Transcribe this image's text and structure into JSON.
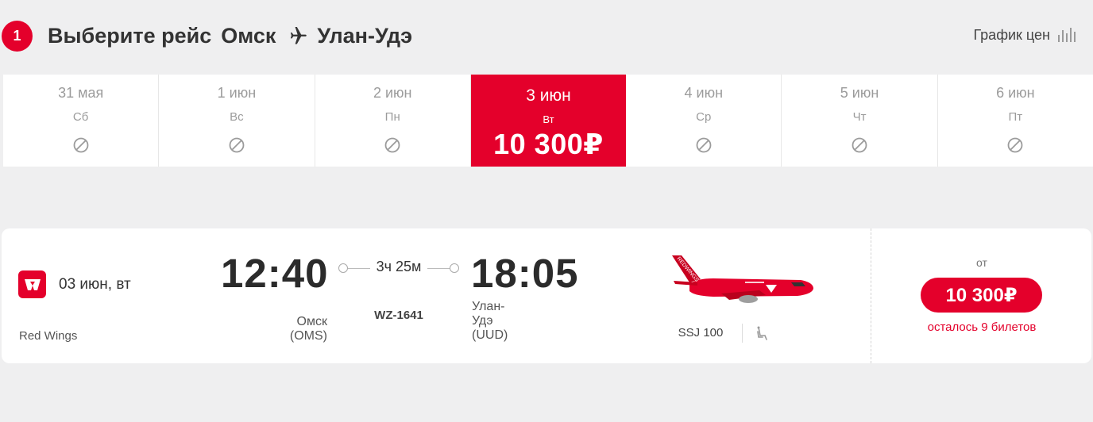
{
  "header": {
    "step": "1",
    "title_prefix": "Выберите рейс",
    "origin": "Омск",
    "destination": "Улан-Удэ",
    "price_chart_label": "График цен"
  },
  "dates": [
    {
      "date": "31 мая",
      "weekday": "Сб",
      "available": false
    },
    {
      "date": "1 июн",
      "weekday": "Вс",
      "available": false
    },
    {
      "date": "2 июн",
      "weekday": "Пн",
      "available": false
    },
    {
      "date": "3 июн",
      "weekday": "Вт",
      "available": true,
      "selected": true,
      "price": "10 300₽"
    },
    {
      "date": "4 июн",
      "weekday": "Ср",
      "available": false
    },
    {
      "date": "5 июн",
      "weekday": "Чт",
      "available": false
    },
    {
      "date": "6 июн",
      "weekday": "Пт",
      "available": false
    }
  ],
  "flight": {
    "date": "03 июн, вт",
    "airline": "Red Wings",
    "departure_time": "12:40",
    "departure_city_line1": "Омск",
    "departure_city_line2": "(OMS)",
    "duration": "3ч 25м",
    "flight_number": "WZ-1641",
    "arrival_time": "18:05",
    "arrival_city_line1": "Улан-",
    "arrival_city_line2": "Удэ",
    "arrival_city_line3": "(UUD)",
    "aircraft": "SSJ 100",
    "price_prefix": "от",
    "price": "10 300₽",
    "seats_left": "осталось 9 билетов"
  },
  "colors": {
    "brand_red": "#e4002b",
    "background": "#efeff0"
  },
  "icons": [
    "plane-icon",
    "price-chart-icon",
    "unavailable-icon",
    "red-wings-logo-icon",
    "seat-icon"
  ]
}
